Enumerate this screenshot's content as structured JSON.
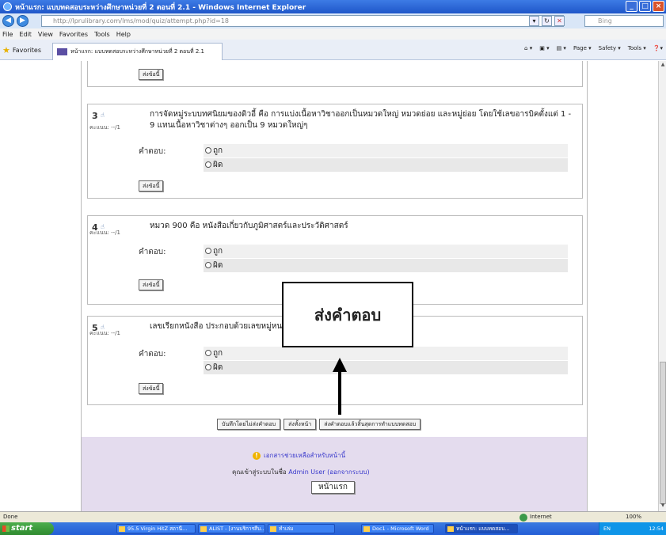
{
  "window": {
    "title": "หน้าแรก: แบบทดสอบระหว่างศึกษาหน่วยที่ 2 ตอนที่ 2.1 - Windows Internet Explorer",
    "controls": [
      "_",
      "□",
      "×"
    ]
  },
  "address": {
    "url_host": "http://lprulibrary.com",
    "url_path": "/lms/mod/quiz/attempt.php?id=18",
    "search_placeholder": "Bing"
  },
  "menu": [
    "File",
    "Edit",
    "View",
    "Favorites",
    "Tools",
    "Help"
  ],
  "favorites": {
    "label": "Favorites",
    "tab_title": "หน้าแรก: แบบทดสอบระหว่างศึกษาหน่วยที่ 2 ตอนที่ 2.1",
    "commands": [
      "Page ▾",
      "Safety ▾",
      "Tools ▾"
    ]
  },
  "quiz": {
    "submit_label": "ส่งข้อนี้",
    "answer_label": "คำตอบ:",
    "options": [
      "ถูก",
      "ผิด"
    ],
    "questions": [
      {
        "number": "3",
        "score": "คะแนน: --/1",
        "text": "การจัดหมู่ระบบทศนิยมของดิวอี้ คือ การแบ่งเนื้อหาวิชาออกเป็นหมวดใหญ่ หมวดย่อย และหมู่ย่อย โดยใช้เลขอารบิคตั้งแต่ 1 - 9 แทนเนื้อหาวิชาต่างๆ ออกเป็น 9 หมวดใหญ่ๆ"
      },
      {
        "number": "4",
        "score": "คะแนน: --/1",
        "text": "หมวด 900 คือ หนังสือเกี่ยวกับภูมิศาสตร์และประวัติศาสตร์"
      },
      {
        "number": "5",
        "score": "คะแนน: --/1",
        "text": "เลขเรียกหนังสือ ประกอบด้วยเลขหมู่หน"
      }
    ],
    "bottom_buttons": [
      "บันทึกโดยไม่ส่งคำตอบ",
      "ส่งทั้งหน้า",
      "ส่งคำตอบแล้วสิ้นสุดการทำแบบทดสอบ"
    ]
  },
  "footer": {
    "help": "เอกสารช่วยเหลือสำหรับหน้านี้",
    "logged_prefix": "คุณเข้าสู่ระบบในชื่อ ",
    "user": "Admin User",
    "logout": "(ออกจากระบบ)",
    "home": "หน้าแรก"
  },
  "annotation": {
    "text": "ส่งคำตอบ"
  },
  "status": {
    "left": "Done",
    "zone": "Internet",
    "zoom": "100%"
  },
  "taskbar": {
    "start": "start",
    "items": [
      "95.5 Virgin HitZ สถานี...",
      "ALIST - [งานบริการสืบ...",
      "ทำเล่ม",
      "Doc1 - Microsoft Word",
      "หน้าแรก: แบบทดสอบ..."
    ],
    "tray": "EN",
    "clock": "12:54"
  },
  "colors": {
    "accent": "#3a3acc",
    "footer_bg": "#e4dcee",
    "titlebar": "#1f56c9"
  }
}
